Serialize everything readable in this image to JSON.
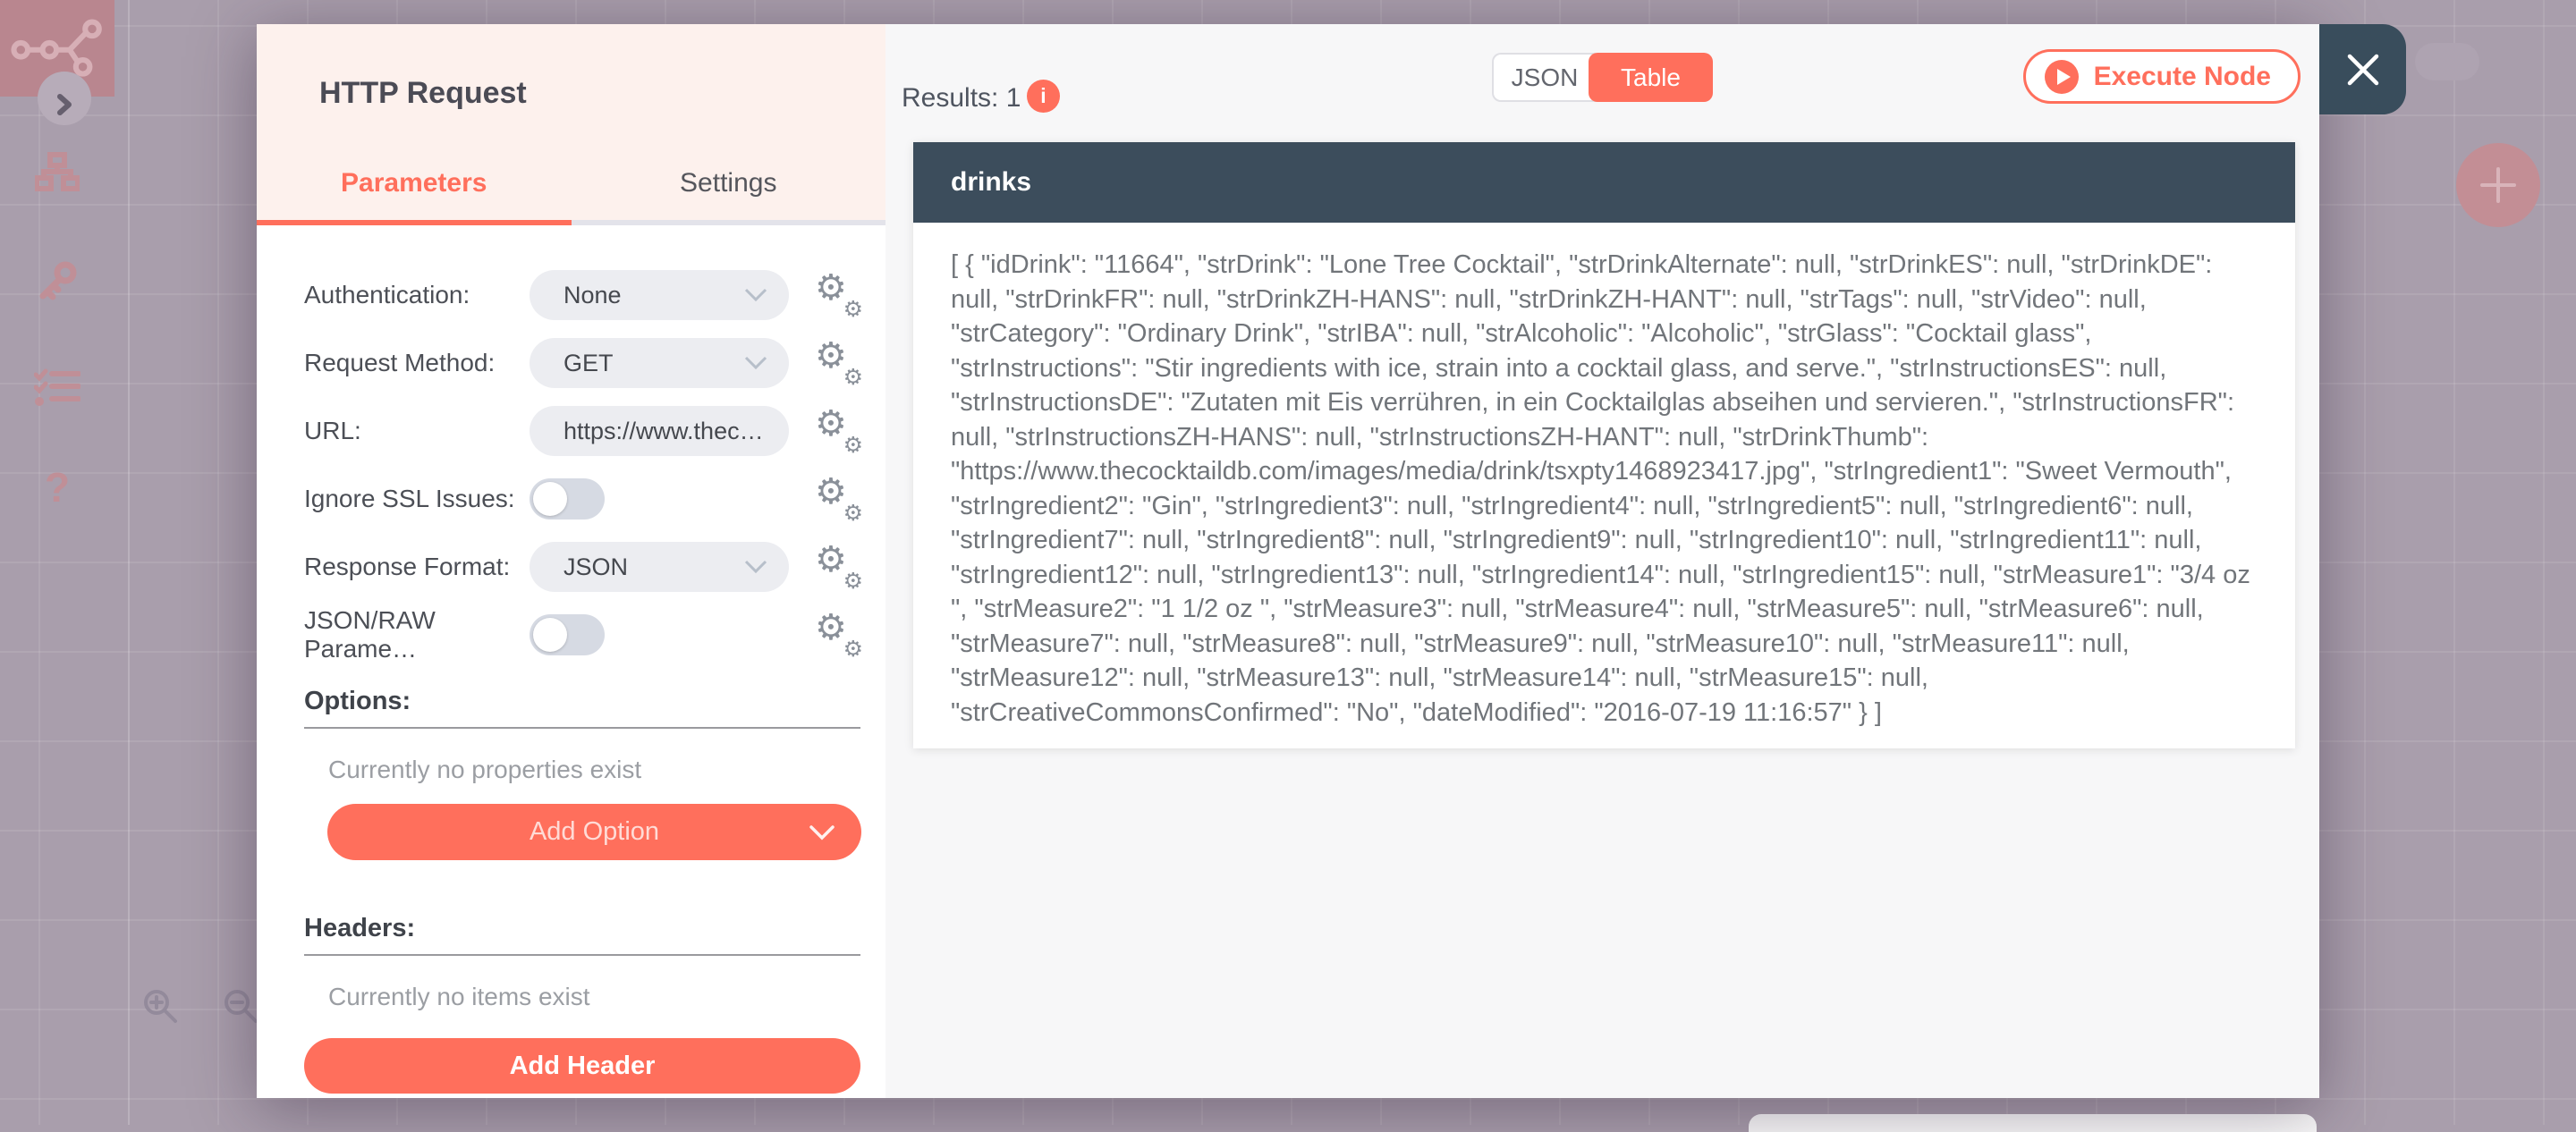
{
  "colors": {
    "accent": "#ff6f5c",
    "slate": "#3c4d5c",
    "canvas_overlay": "#a99eac"
  },
  "icons": {
    "gear": "⚙",
    "help": "?",
    "info": "i"
  },
  "node_panel": {
    "title": "HTTP Request",
    "tabs": {
      "parameters": "Parameters",
      "settings": "Settings",
      "active": "Parameters"
    },
    "fields": [
      {
        "label": "Authentication:",
        "value": "None",
        "type": "select"
      },
      {
        "label": "Request Method:",
        "value": "GET",
        "type": "select"
      },
      {
        "label": "URL:",
        "value": "https://www.thec…",
        "type": "text"
      },
      {
        "label": "Ignore SSL Issues:",
        "value": "off",
        "type": "toggle"
      },
      {
        "label": "Response Format:",
        "value": "JSON",
        "type": "select"
      },
      {
        "label": "JSON/RAW Parame…",
        "value": "off",
        "type": "toggle"
      }
    ],
    "options_section": {
      "heading": "Options:",
      "empty": "Currently no properties exist",
      "button": "Add Option"
    },
    "headers_section": {
      "heading": "Headers:",
      "empty": "Currently no items exist",
      "button": "Add Header"
    }
  },
  "results": {
    "label": "Results: 1",
    "views": {
      "json": "JSON",
      "table": "Table",
      "active": "Table"
    },
    "execute_button": "Execute Node",
    "table_header": "drinks",
    "json_body": "[ { \"idDrink\": \"11664\", \"strDrink\": \"Lone Tree Cocktail\", \"strDrinkAlternate\": null, \"strDrinkES\": null, \"strDrinkDE\": null, \"strDrinkFR\": null, \"strDrinkZH-HANS\": null, \"strDrinkZH-HANT\": null, \"strTags\": null, \"strVideo\": null, \"strCategory\": \"Ordinary Drink\", \"strIBA\": null, \"strAlcoholic\": \"Alcoholic\", \"strGlass\": \"Cocktail glass\", \"strInstructions\": \"Stir ingredients with ice, strain into a cocktail glass, and serve.\", \"strInstructionsES\": null, \"strInstructionsDE\": \"Zutaten mit Eis verrühren, in ein Cocktailglas abseihen und servieren.\", \"strInstructionsFR\": null, \"strInstructionsZH-HANS\": null, \"strInstructionsZH-HANT\": null, \"strDrinkThumb\": \"https://www.thecocktaildb.com/images/media/drink/tsxpty1468923417.jpg\", \"strIngredient1\": \"Sweet Vermouth\", \"strIngredient2\": \"Gin\", \"strIngredient3\": null, \"strIngredient4\": null, \"strIngredient5\": null, \"strIngredient6\": null, \"strIngredient7\": null, \"strIngredient8\": null, \"strIngredient9\": null, \"strIngredient10\": null, \"strIngredient11\": null, \"strIngredient12\": null, \"strIngredient13\": null, \"strIngredient14\": null, \"strIngredient15\": null, \"strMeasure1\": \"3/4 oz \", \"strMeasure2\": \"1 1/2 oz \", \"strMeasure3\": null, \"strMeasure4\": null, \"strMeasure5\": null, \"strMeasure6\": null, \"strMeasure7\": null, \"strMeasure8\": null, \"strMeasure9\": null, \"strMeasure10\": null, \"strMeasure11\": null, \"strMeasure12\": null, \"strMeasure13\": null, \"strMeasure14\": null, \"strMeasure15\": null, \"strCreativeCommonsConfirmed\": \"No\", \"dateModified\": \"2016-07-19 11:16:57\" } ]"
  }
}
